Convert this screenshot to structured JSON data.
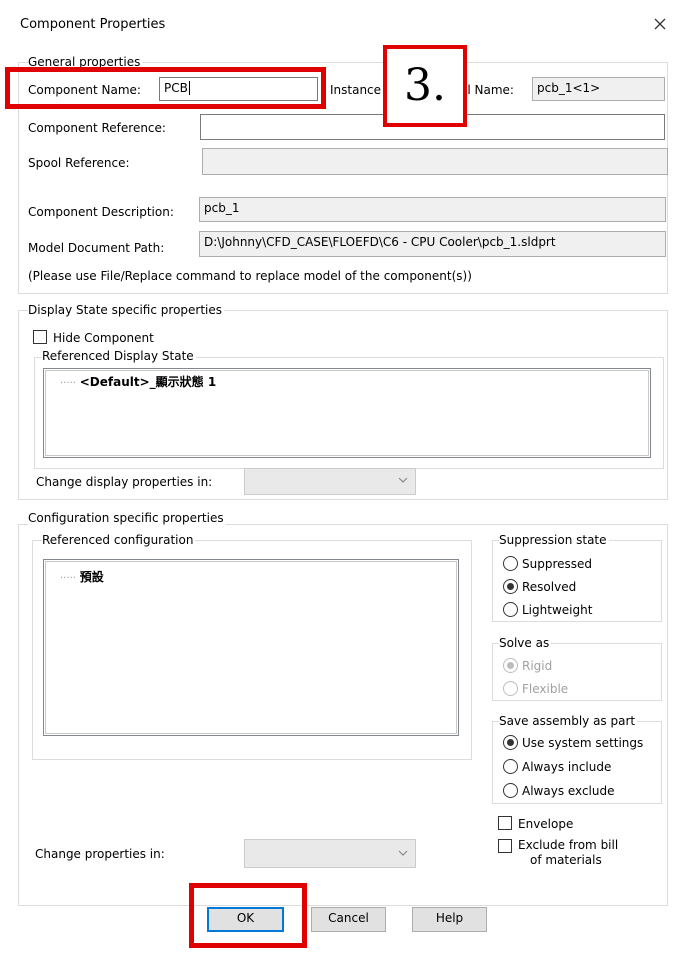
{
  "window": {
    "title": "Component Properties"
  },
  "general": {
    "legend": "General properties",
    "component_name_label": "Component Name:",
    "component_name_value": "PCB",
    "instance_label": "Instance",
    "full_name_label": "ll Name:",
    "full_name_value": "pcb_1<1>",
    "component_reference_label": "Component Reference:",
    "component_reference_value": "",
    "spool_reference_label": "Spool Reference:",
    "spool_reference_value": "",
    "component_description_label": "Component Description:",
    "component_description_value": "pcb_1",
    "model_document_path_label": "Model Document Path:",
    "model_document_path_value": "D:\\Johnny\\CFD_CASE\\FLOEFD\\C6 - CPU Cooler\\pcb_1.sldprt",
    "replace_note": "(Please use File/Replace command to replace model of the component(s))"
  },
  "display_state": {
    "legend": "Display State specific properties",
    "hide_component_label": "Hide Component",
    "hide_component_checked": false,
    "referenced_display_state_label": "Referenced Display State",
    "tree_prefix": "·····",
    "display_states": [
      "<Default>_顯示狀態 1"
    ],
    "change_display_label": "Change display properties in:",
    "change_display_value": ""
  },
  "configuration": {
    "legend": "Configuration specific properties",
    "referenced_configuration_label": "Referenced configuration",
    "configurations": [
      "預設"
    ],
    "change_properties_label": "Change properties in:",
    "change_properties_value": ""
  },
  "suppression": {
    "legend": "Suppression state",
    "options": [
      "Suppressed",
      "Resolved",
      "Lightweight"
    ],
    "selected": "Resolved"
  },
  "solve_as": {
    "legend": "Solve as",
    "options": [
      "Rigid",
      "Flexible"
    ],
    "selected": "Rigid",
    "disabled": true
  },
  "save_assembly": {
    "legend": "Save assembly as part",
    "options": [
      "Use system settings",
      "Always include",
      "Always exclude"
    ],
    "selected": "Use system settings"
  },
  "envelope_label": "Envelope",
  "exclude_bom_label_line1": "Exclude from bill",
  "exclude_bom_label_line2": "of materials",
  "buttons": {
    "ok": "OK",
    "cancel": "Cancel",
    "help": "Help"
  },
  "annotation": {
    "step_label": "3."
  },
  "colors": {
    "highlight": "#e00000",
    "default_button_border": "#0078d7"
  },
  "icons": {
    "close": "close-icon",
    "chevron": "chevron-down-icon"
  }
}
